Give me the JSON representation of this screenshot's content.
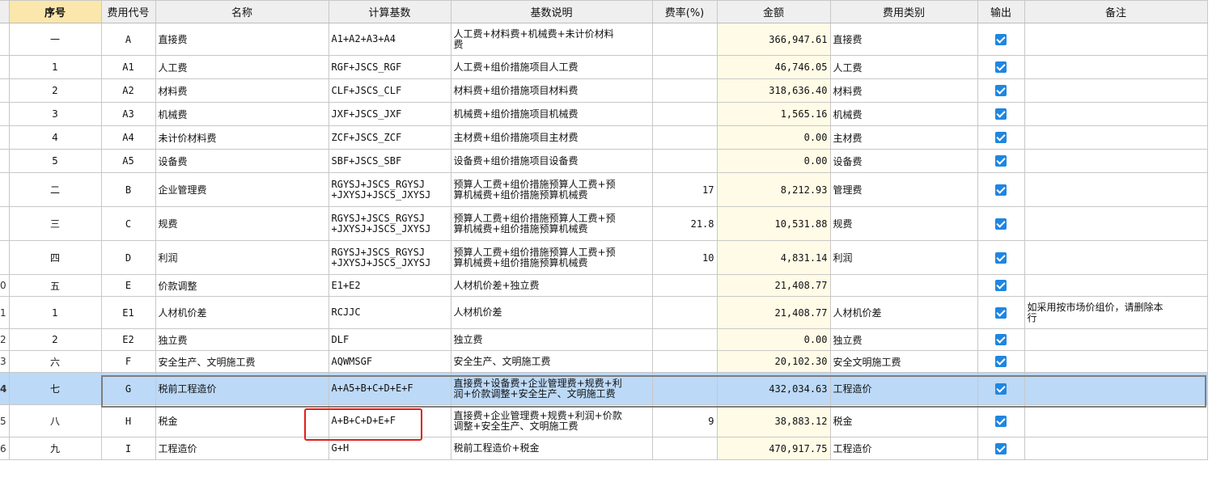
{
  "headers": {
    "seq": "序号",
    "code": "费用代号",
    "name": "名称",
    "basis": "计算基数",
    "desc": "基数说明",
    "rate": "费率(%)",
    "amount": "金额",
    "category": "费用类别",
    "output": "输出",
    "remark": "备注"
  },
  "rows": [
    {
      "rownum": "",
      "seq": "一",
      "code": "A",
      "name": "直接费",
      "basis": "A1+A2+A3+A4",
      "desc": "人工费+材料费+机械费+未计价材料\n费",
      "rate": "",
      "amount": "366,947.61",
      "category": "直接费",
      "output": true,
      "remark": ""
    },
    {
      "rownum": "",
      "seq": "1",
      "code": "A1",
      "name": "人工费",
      "basis": "RGF+JSCS_RGF",
      "desc": "人工费+组价措施项目人工费",
      "rate": "",
      "amount": "46,746.05",
      "category": "人工费",
      "output": true,
      "remark": ""
    },
    {
      "rownum": "",
      "seq": "2",
      "code": "A2",
      "name": "材料费",
      "basis": "CLF+JSCS_CLF",
      "desc": "材料费+组价措施项目材料费",
      "rate": "",
      "amount": "318,636.40",
      "category": "材料费",
      "output": true,
      "remark": ""
    },
    {
      "rownum": "",
      "seq": "3",
      "code": "A3",
      "name": "机械费",
      "basis": "JXF+JSCS_JXF",
      "desc": "机械费+组价措施项目机械费",
      "rate": "",
      "amount": "1,565.16",
      "category": "机械费",
      "output": true,
      "remark": ""
    },
    {
      "rownum": "",
      "seq": "4",
      "code": "A4",
      "name": "未计价材料费",
      "basis": "ZCF+JSCS_ZCF",
      "desc": "主材费+组价措施项目主材费",
      "rate": "",
      "amount": "0.00",
      "category": "主材费",
      "output": true,
      "remark": ""
    },
    {
      "rownum": "",
      "seq": "5",
      "code": "A5",
      "name": "设备费",
      "basis": "SBF+JSCS_SBF",
      "desc": "设备费+组价措施项目设备费",
      "rate": "",
      "amount": "0.00",
      "category": "设备费",
      "output": true,
      "remark": ""
    },
    {
      "rownum": "",
      "seq": "二",
      "code": "B",
      "name": "企业管理费",
      "basis": "RGYSJ+JSCS_RGYSJ\n+JXYSJ+JSCS_JXYSJ",
      "desc": "预算人工费+组价措施预算人工费+预\n算机械费+组价措施预算机械费",
      "rate": "17",
      "amount": "8,212.93",
      "category": "管理费",
      "output": true,
      "remark": ""
    },
    {
      "rownum": "",
      "seq": "三",
      "code": "C",
      "name": "规费",
      "basis": "RGYSJ+JSCS_RGYSJ\n+JXYSJ+JSCS_JXYSJ",
      "desc": "预算人工费+组价措施预算人工费+预\n算机械费+组价措施预算机械费",
      "rate": "21.8",
      "amount": "10,531.88",
      "category": "规费",
      "output": true,
      "remark": ""
    },
    {
      "rownum": "",
      "seq": "四",
      "code": "D",
      "name": "利润",
      "basis": "RGYSJ+JSCS_RGYSJ\n+JXYSJ+JSCS_JXYSJ",
      "desc": "预算人工费+组价措施预算人工费+预\n算机械费+组价措施预算机械费",
      "rate": "10",
      "amount": "4,831.14",
      "category": "利润",
      "output": true,
      "remark": ""
    },
    {
      "rownum": "0",
      "seq": "五",
      "code": "E",
      "name": "价款调整",
      "basis": "E1+E2",
      "desc": "人材机价差+独立费",
      "rate": "",
      "amount": "21,408.77",
      "category": "",
      "output": true,
      "remark": ""
    },
    {
      "rownum": "1",
      "seq": "1",
      "code": "E1",
      "name": "人材机价差",
      "basis": "RCJJC",
      "desc": "人材机价差",
      "rate": "",
      "amount": "21,408.77",
      "category": "人材机价差",
      "output": true,
      "remark": "如采用按市场价组价，请删除本\n行"
    },
    {
      "rownum": "2",
      "seq": "2",
      "code": "E2",
      "name": "独立费",
      "basis": "DLF",
      "desc": "独立费",
      "rate": "",
      "amount": "0.00",
      "category": "独立费",
      "output": true,
      "remark": ""
    },
    {
      "rownum": "3",
      "seq": "六",
      "code": "F",
      "name": "安全生产、文明施工费",
      "basis": "AQWMSGF",
      "desc": "安全生产、文明施工费",
      "rate": "",
      "amount": "20,102.30",
      "category": "安全文明施工费",
      "output": true,
      "remark": ""
    },
    {
      "rownum": "4",
      "seq": "七",
      "code": "G",
      "name": "税前工程造价",
      "basis": "A+A5+B+C+D+E+F",
      "desc": "直接费+设备费+企业管理费+规费+利\n润+价款调整+安全生产、文明施工费",
      "rate": "",
      "amount": "432,034.63",
      "category": "工程造价",
      "output": true,
      "remark": ""
    },
    {
      "rownum": "5",
      "seq": "八",
      "code": "H",
      "name": "税金",
      "basis": "A+B+C+D+E+F",
      "desc": "直接费+企业管理费+规费+利润+价款\n调整+安全生产、文明施工费",
      "rate": "9",
      "amount": "38,883.12",
      "category": "税金",
      "output": true,
      "remark": ""
    },
    {
      "rownum": "6",
      "seq": "九",
      "code": "I",
      "name": "工程造价",
      "basis": "G+H",
      "desc": "税前工程造价+税金",
      "rate": "",
      "amount": "470,917.75",
      "category": "工程造价",
      "output": true,
      "remark": ""
    }
  ],
  "selected_row_index": 13,
  "colors": {
    "selected_row": "#bcd9f7",
    "amount_bg": "#fffbe6",
    "header_seq_bg": "#fbe7ac",
    "checkbox": "#1f86e0",
    "highlight_box": "#e0201a"
  }
}
